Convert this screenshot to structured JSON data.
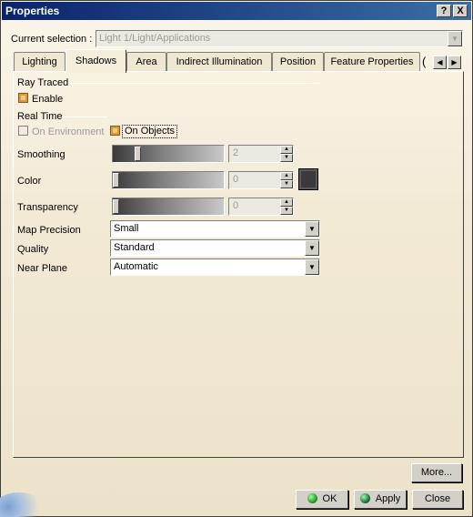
{
  "window": {
    "title": "Properties",
    "help_btn": "?",
    "close_btn": "X"
  },
  "selection": {
    "label": "Current selection :",
    "value": "Light 1/Light/Applications"
  },
  "tabs": [
    {
      "label": "Lighting"
    },
    {
      "label": "Shadows"
    },
    {
      "label": "Area"
    },
    {
      "label": "Indirect Illumination"
    },
    {
      "label": "Position"
    },
    {
      "label": "Feature Properties"
    }
  ],
  "tab_overflow": "(",
  "ray_traced": {
    "title": "Ray Traced",
    "enable_label": "Enable",
    "enable_checked": true
  },
  "real_time": {
    "title": "Real Time",
    "on_environment_label": "On Environment",
    "on_environment_checked": false,
    "on_objects_label": "On Objects",
    "on_objects_checked": true
  },
  "smoothing": {
    "label": "Smoothing",
    "value": "2"
  },
  "color": {
    "label": "Color",
    "value": "0",
    "swatch": "#3a3a3a"
  },
  "transparency": {
    "label": "Transparency",
    "value": "0"
  },
  "map_precision": {
    "label": "Map Precision",
    "value": "Small"
  },
  "quality": {
    "label": "Quality",
    "value": "Standard"
  },
  "near_plane": {
    "label": "Near Plane",
    "value": "Automatic"
  },
  "buttons": {
    "more": "More...",
    "ok": "OK",
    "apply": "Apply",
    "close": "Close"
  },
  "colors": {
    "titlebar_start": "#0a246a",
    "titlebar_end": "#3a6ea5",
    "checkbox_orange": "#d99a3a"
  }
}
